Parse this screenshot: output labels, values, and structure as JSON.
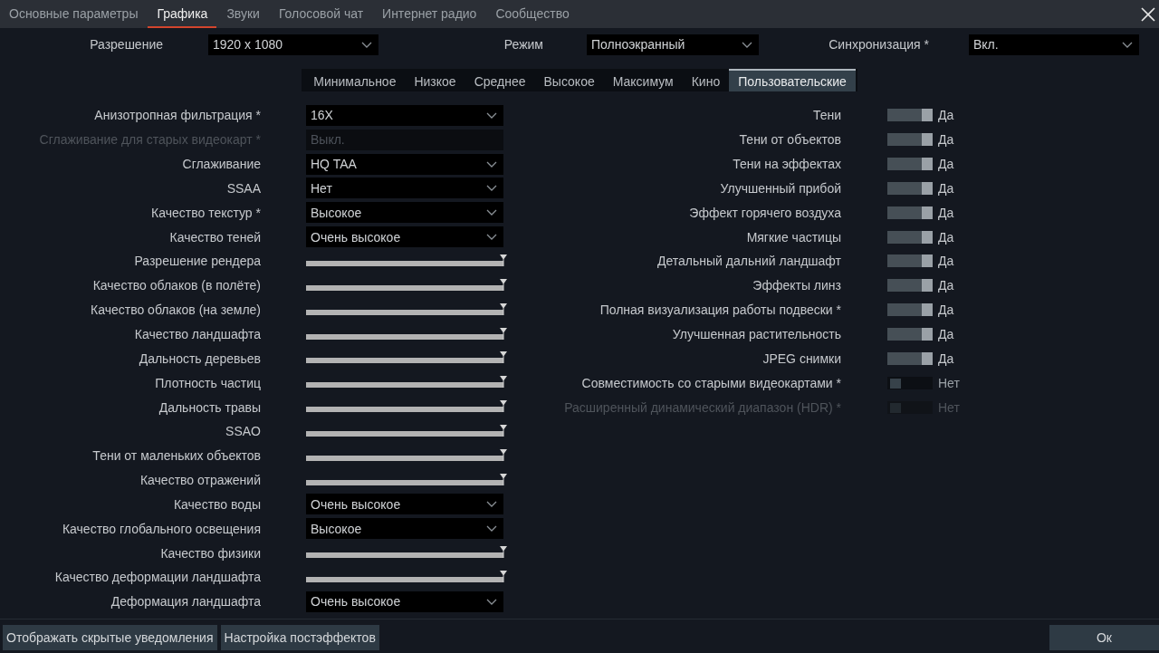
{
  "tabs": [
    {
      "label": "Основные параметры",
      "selected": false
    },
    {
      "label": "Графика",
      "selected": true
    },
    {
      "label": "Звуки",
      "selected": false
    },
    {
      "label": "Голосовой чат",
      "selected": false
    },
    {
      "label": "Интернет радио",
      "selected": false
    },
    {
      "label": "Сообщество",
      "selected": false
    }
  ],
  "top_settings": [
    {
      "label": "Разрешение",
      "value": "1920 x 1080"
    },
    {
      "label": "Режим",
      "value": "Полноэкранный"
    },
    {
      "label": "Синхронизация *",
      "value": "Вкл."
    }
  ],
  "presets": [
    {
      "label": "Минимальное",
      "selected": false
    },
    {
      "label": "Низкое",
      "selected": false
    },
    {
      "label": "Среднее",
      "selected": false
    },
    {
      "label": "Высокое",
      "selected": false
    },
    {
      "label": "Максимум",
      "selected": false
    },
    {
      "label": "Кино",
      "selected": false
    },
    {
      "label": "Пользовательские",
      "selected": true
    }
  ],
  "left_settings": [
    {
      "kind": "select",
      "label": "Анизотропная фильтрация *",
      "value": "16X",
      "disabled": false
    },
    {
      "kind": "select",
      "label": "Сглаживание для старых видеокарт *",
      "value": "Выкл.",
      "disabled": true
    },
    {
      "kind": "select",
      "label": "Сглаживание",
      "value": "HQ TAA",
      "disabled": false
    },
    {
      "kind": "select",
      "label": "SSAA",
      "value": "Нет",
      "disabled": false
    },
    {
      "kind": "select",
      "label": "Качество текстур *",
      "value": "Высокое",
      "disabled": false
    },
    {
      "kind": "select",
      "label": "Качество теней",
      "value": "Очень высокое",
      "disabled": false
    },
    {
      "kind": "slider",
      "label": "Разрешение рендера",
      "level": 1
    },
    {
      "kind": "slider",
      "label": "Качество облаков (в полёте)",
      "level": 1
    },
    {
      "kind": "slider",
      "label": "Качество облаков (на земле)",
      "level": 1
    },
    {
      "kind": "slider",
      "label": "Качество ландшафта",
      "level": 1
    },
    {
      "kind": "slider",
      "label": "Дальность деревьев",
      "level": 1
    },
    {
      "kind": "slider",
      "label": "Плотность частиц",
      "level": 1
    },
    {
      "kind": "slider",
      "label": "Дальность травы",
      "level": 1
    },
    {
      "kind": "slider",
      "label": "SSAO",
      "level": 1
    },
    {
      "kind": "slider",
      "label": "Тени от маленьких объектов",
      "level": 1
    },
    {
      "kind": "slider",
      "label": "Качество отражений",
      "level": 1
    },
    {
      "kind": "select",
      "label": "Качество воды",
      "value": "Очень высокое",
      "disabled": false
    },
    {
      "kind": "select",
      "label": "Качество глобального освещения",
      "value": "Высокое",
      "disabled": false
    },
    {
      "kind": "slider",
      "label": "Качество физики",
      "level": 1
    },
    {
      "kind": "slider",
      "label": "Качество деформации ландшафта",
      "level": 1
    },
    {
      "kind": "select",
      "label": "Деформация ландшафта",
      "value": "Очень высокое",
      "disabled": false
    }
  ],
  "right_settings": [
    {
      "label": "Тени",
      "on": true,
      "value": "Да",
      "disabled": false
    },
    {
      "label": "Тени от объектов",
      "on": true,
      "value": "Да",
      "disabled": false
    },
    {
      "label": "Тени на эффектах",
      "on": true,
      "value": "Да",
      "disabled": false
    },
    {
      "label": "Улучшенный прибой",
      "on": true,
      "value": "Да",
      "disabled": false
    },
    {
      "label": "Эффект горячего воздуха",
      "on": true,
      "value": "Да",
      "disabled": false
    },
    {
      "label": "Мягкие частицы",
      "on": true,
      "value": "Да",
      "disabled": false
    },
    {
      "label": "Детальный дальний ландшафт",
      "on": true,
      "value": "Да",
      "disabled": false
    },
    {
      "label": "Эффекты линз",
      "on": true,
      "value": "Да",
      "disabled": false
    },
    {
      "label": "Полная визуализация работы подвески *",
      "on": true,
      "value": "Да",
      "disabled": false
    },
    {
      "label": "Улучшенная растительность",
      "on": true,
      "value": "Да",
      "disabled": false
    },
    {
      "label": "JPEG снимки",
      "on": true,
      "value": "Да",
      "disabled": false
    },
    {
      "label": "Совместимость со старыми видеокартами *",
      "on": false,
      "value": "Нет",
      "disabled": false
    },
    {
      "label": "Расширенный динамический диапазон (HDR) *",
      "on": false,
      "value": "Нет",
      "disabled": true
    }
  ],
  "footer_buttons": [
    "Отображать скрытые уведомления",
    "Настройка постэффектов"
  ],
  "ok_button": "Ок"
}
